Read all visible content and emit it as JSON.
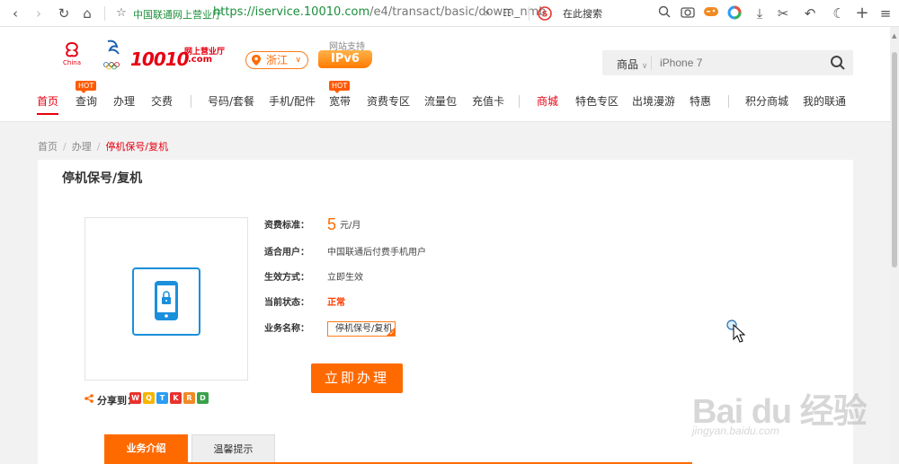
{
  "browser": {
    "site_name": "中国联通网上营业厅",
    "url_main": "https://iservice.10010.com",
    "url_rest": "/e4/transact/basic/dowm_nmb",
    "search_placeholder": "在此搜索",
    "icons": [
      "back-icon",
      "forward-icon",
      "reload-icon",
      "home-icon",
      "star-icon",
      "lightning-icon",
      "qr-icon",
      "sogou-icon",
      "search-icon",
      "camera-icon",
      "game-icon",
      "color-icon",
      "download-icon",
      "scissors-icon",
      "undo-icon",
      "moon-icon",
      "plus-icon",
      "menu-icon"
    ]
  },
  "header": {
    "logo_text": "10010",
    "logo_sub": "网上营业厅",
    "logo_com": ".com",
    "region": "浙江",
    "ipv6_label": "网站支持",
    "ipv6_badge": "IPv6",
    "search_category": "商品",
    "search_placeholder": "iPhone 7"
  },
  "nav": {
    "items": [
      {
        "label": "首页",
        "active": true
      },
      {
        "label": "查询",
        "hot": "HOT"
      },
      {
        "label": "办理"
      },
      {
        "label": "交费"
      },
      {
        "label": "号码/套餐"
      },
      {
        "label": "手机/配件"
      },
      {
        "label": "宽带",
        "hot": "HOT"
      },
      {
        "label": "资费专区"
      },
      {
        "label": "流量包"
      },
      {
        "label": "充值卡"
      },
      {
        "label": "商城"
      },
      {
        "label": "特色专区"
      },
      {
        "label": "出境漫游"
      },
      {
        "label": "特惠"
      },
      {
        "label": "积分商城"
      },
      {
        "label": "我的联通"
      }
    ]
  },
  "breadcrumb": {
    "home": "首页",
    "section": "办理",
    "current": "停机保号/复机"
  },
  "page": {
    "title": "停机保号/复机",
    "share_label": "分享到：",
    "share_icons": [
      "weibo-icon",
      "qzone-icon",
      "tencent-weibo-icon",
      "kaixin-icon",
      "renren-icon",
      "douban-icon"
    ],
    "fee_label": "资费标准：",
    "fee_value": "5",
    "fee_unit": "元/月",
    "users_label": "适合用户：",
    "users_value": "中国联通后付费手机用户",
    "effect_label": "生效方式：",
    "effect_value": "立即生效",
    "status_label": "当前状态：",
    "status_value": "正常",
    "biz_label": "业务名称：",
    "biz_value": "停机保号/复机",
    "apply_button": "立即办理",
    "tabs": [
      "业务介绍",
      "温馨提示"
    ]
  },
  "watermark": {
    "text": "Bai du 经验",
    "url": "jingyan.baidu.com"
  },
  "colors": {
    "brand_red": "#e60012",
    "accent_orange": "#ff6a00",
    "icon_blue": "#1a8fdc"
  }
}
